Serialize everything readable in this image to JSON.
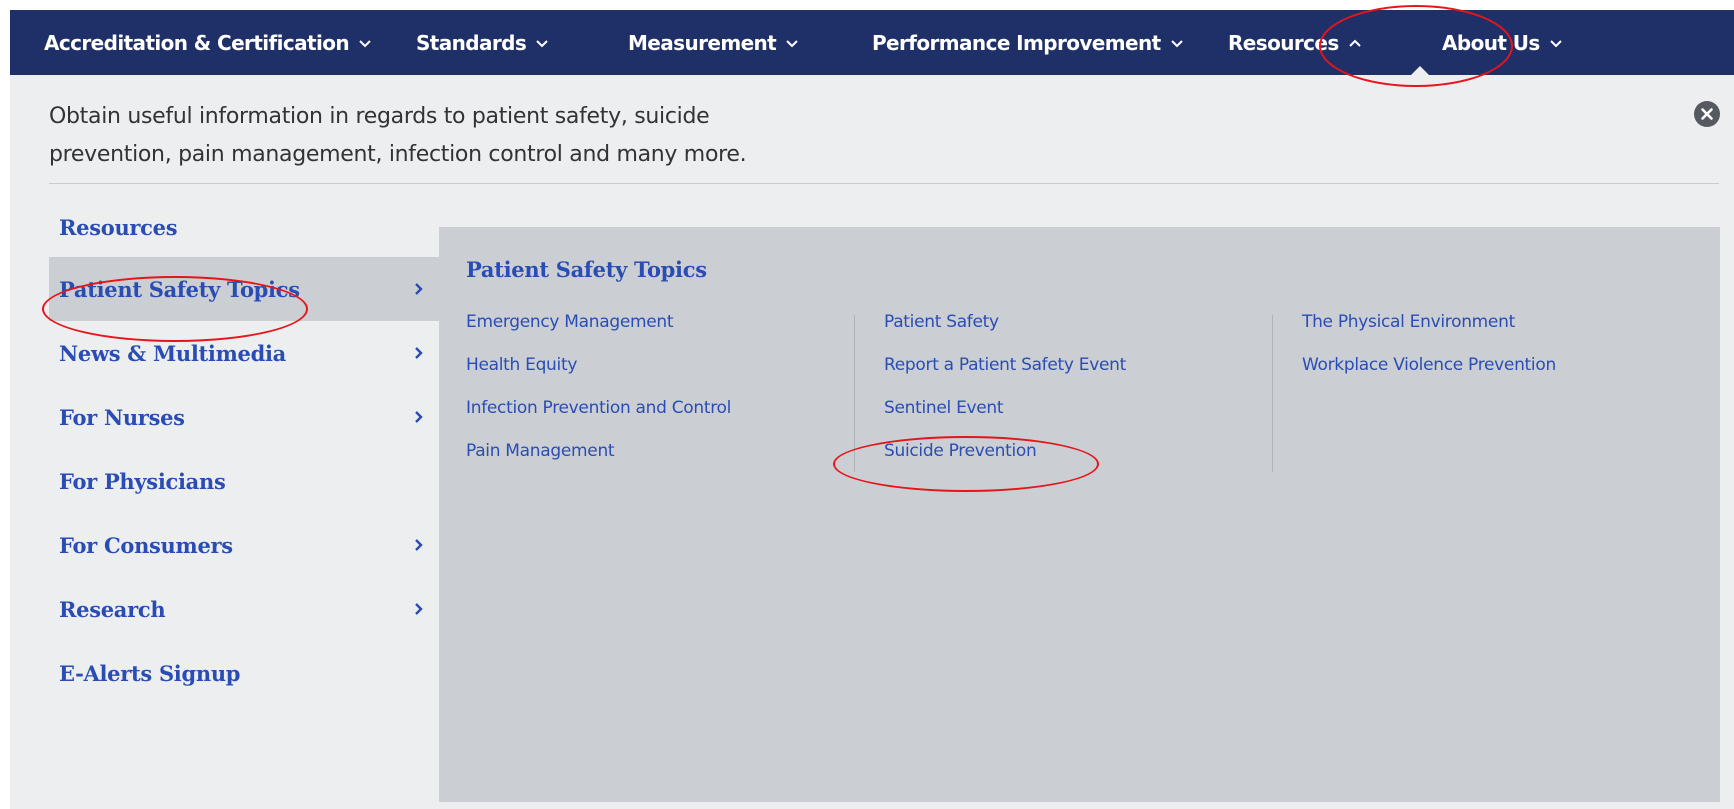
{
  "nav": {
    "items": [
      {
        "label": "Accreditation & Certification",
        "chevron": "down"
      },
      {
        "label": "Standards",
        "chevron": "down"
      },
      {
        "label": "Measurement",
        "chevron": "down"
      },
      {
        "label": "Performance Improvement",
        "chevron": "down"
      },
      {
        "label": "Resources",
        "chevron": "up",
        "active": true
      },
      {
        "label": "About Us",
        "chevron": "down"
      }
    ]
  },
  "dropdown": {
    "description": "Obtain useful information in regards to patient safety, suicide prevention, pain management, infection control and many more.",
    "close_icon": "close-circle-icon",
    "left_menu": {
      "heading": "Resources",
      "items": [
        {
          "label": "Patient Safety Topics",
          "has_submenu": true,
          "active": true
        },
        {
          "label": "News & Multimedia",
          "has_submenu": true
        },
        {
          "label": "For Nurses",
          "has_submenu": true
        },
        {
          "label": "For Physicians",
          "has_submenu": false
        },
        {
          "label": "For Consumers",
          "has_submenu": true
        },
        {
          "label": "Research",
          "has_submenu": true
        },
        {
          "label": "E-Alerts Signup",
          "has_submenu": false
        }
      ]
    },
    "panel": {
      "title": "Patient Safety Topics",
      "columns": [
        [
          "Emergency Management",
          "Health Equity",
          "Infection Prevention and Control",
          "Pain Management"
        ],
        [
          "Patient Safety",
          "Report a Patient Safety Event",
          "Sentinel Event",
          "Suicide Prevention"
        ],
        [
          "The Physical Environment",
          "Workplace Violence Prevention"
        ]
      ]
    }
  },
  "colors": {
    "nav_background": "#1e3067",
    "link_blue": "#2a4db4",
    "panel_background": "#cbcfd3",
    "page_background": "#edeef0",
    "annotation_red": "#e8141b"
  }
}
